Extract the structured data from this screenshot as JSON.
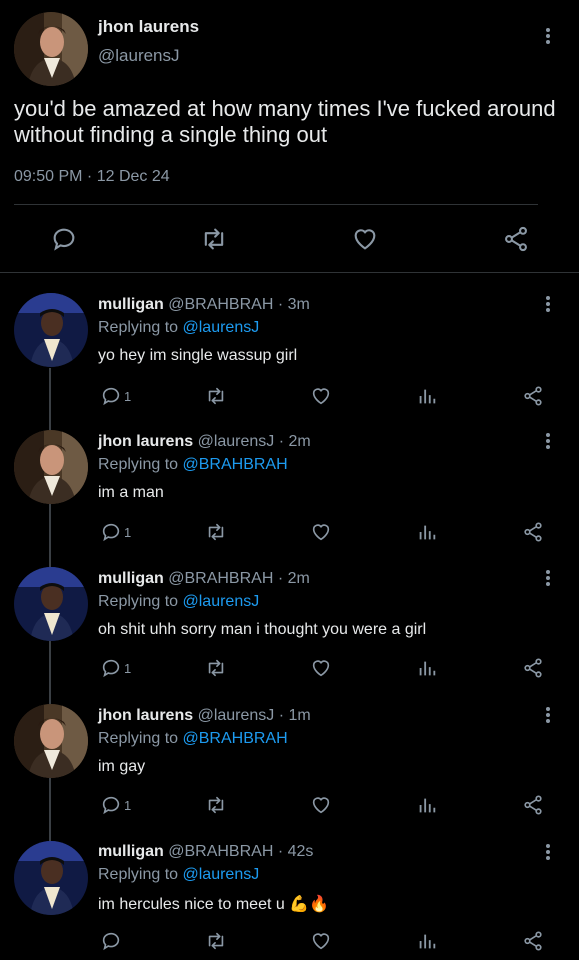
{
  "main_tweet": {
    "author_name": "jhon laurens",
    "author_handle": "@laurensJ",
    "text_line1": "you'd be amazed at how many times I've fucked around",
    "text_line2": "without finding a single thing out",
    "time": "09:50 PM",
    "date": "12 Dec 24",
    "icons": [
      "reply-icon",
      "retweet-icon",
      "like-icon",
      "share-icon"
    ]
  },
  "replies": [
    {
      "name": "mulligan",
      "handle": "@BRAHBRAH",
      "time": "3m",
      "replying_label": "Replying to",
      "replying_to": "@laurensJ",
      "text": "yo hey im single wassup girl",
      "reply_count": "1"
    },
    {
      "name": "jhon laurens",
      "handle": "@laurensJ",
      "time": "2m",
      "replying_label": "Replying to",
      "replying_to": "@BRAHBRAH",
      "text": "im a man",
      "reply_count": "1"
    },
    {
      "name": "mulligan",
      "handle": "@BRAHBRAH",
      "time": "2m",
      "replying_label": "Replying to",
      "replying_to": "@laurensJ",
      "text": "oh shit uhh sorry man i thought you were a girl",
      "reply_count": "1"
    },
    {
      "name": "jhon laurens",
      "handle": "@laurensJ",
      "time": "1m",
      "replying_label": "Replying to",
      "replying_to": "@BRAHBRAH",
      "text": "im gay",
      "reply_count": "1"
    },
    {
      "name": "mulligan",
      "handle": "@BRAHBRAH",
      "time": "42s",
      "replying_label": "Replying to",
      "replying_to": "@laurensJ",
      "text": "im hercules nice to meet u",
      "reply_count": ""
    }
  ],
  "emoji": {
    "flex": "💪",
    "fire": "🔥"
  },
  "colors": {
    "background": "#000000",
    "text": "#e7e9ea",
    "muted": "#8b98a5",
    "link": "#1d9bf0",
    "divider": "#2f3336"
  }
}
